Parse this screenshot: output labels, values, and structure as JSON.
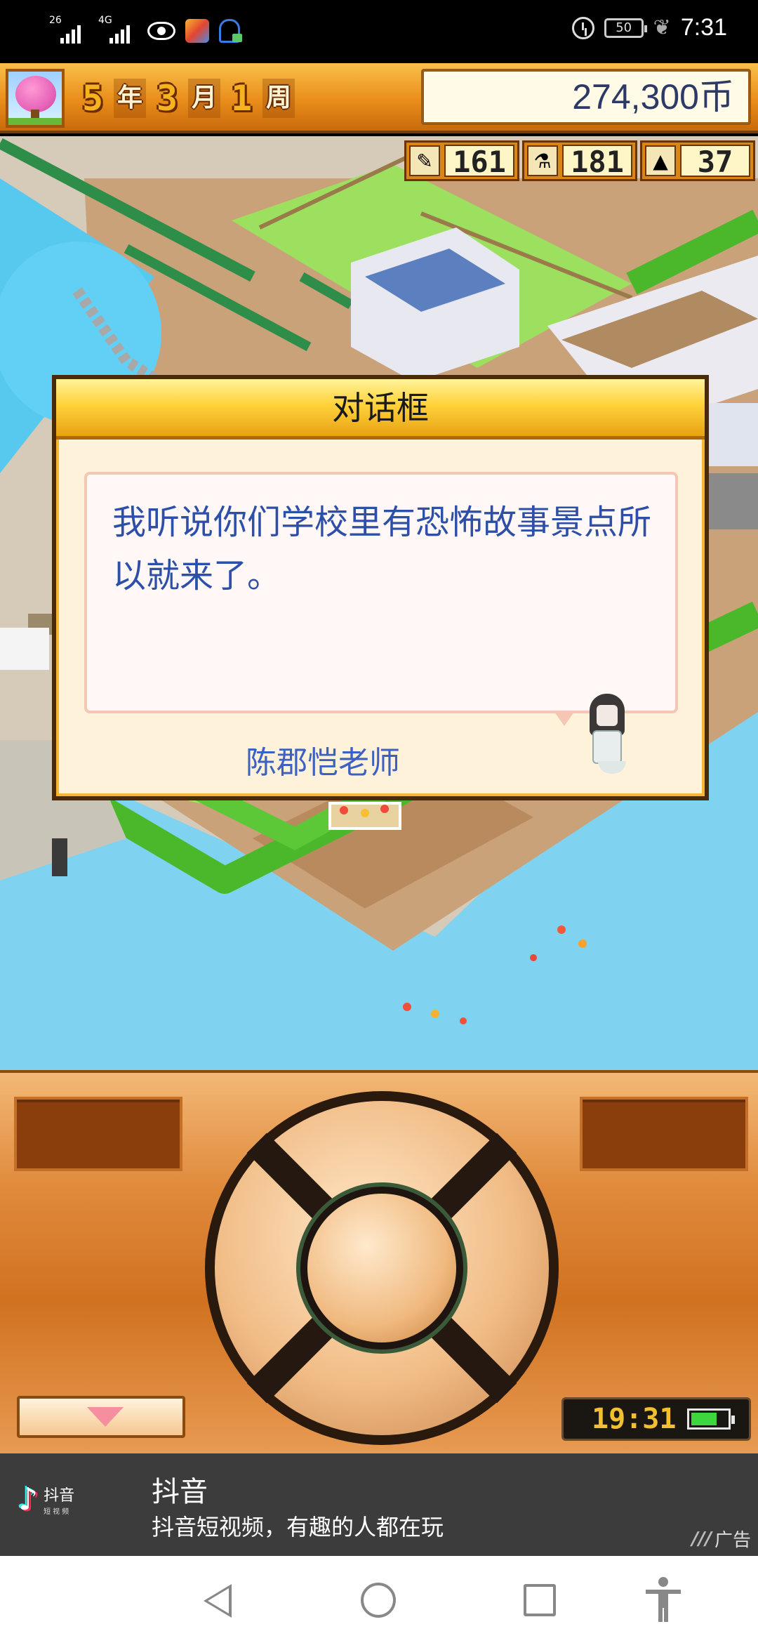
{
  "status_bar": {
    "sim1_tag": "26",
    "sim2_tag": "4G",
    "battery": "50",
    "time": "7:31"
  },
  "hud": {
    "year_num": "5",
    "year_unit": "年",
    "month_num": "3",
    "month_unit": "月",
    "week_num": "1",
    "week_unit": "周",
    "money": "274,300币"
  },
  "stats": [
    {
      "icon": "pencil-icon",
      "glyph": "✎",
      "value": "161"
    },
    {
      "icon": "flask-icon",
      "glyph": "⚗",
      "value": "181"
    },
    {
      "icon": "pyramid-icon",
      "glyph": "▲",
      "value": "37"
    }
  ],
  "dialog": {
    "title": "对话框",
    "message": "我听说你们学校里有恐怖故事景点所以就来了。",
    "speaker": "陈郡恺老师"
  },
  "controller": {
    "clock": "19:31"
  },
  "ad": {
    "logo_text": "抖音",
    "logo_sub": "短视频",
    "title": "抖音",
    "description": "抖音短视频，有趣的人都在玩",
    "tag": "广告"
  },
  "colors": {
    "hud_orange": "#e98d1a",
    "dialog_header": "#ffd23a",
    "dialog_text": "#2e4fa8",
    "controller_orange": "#d07220",
    "ad_bg": "#3c3c3c"
  }
}
